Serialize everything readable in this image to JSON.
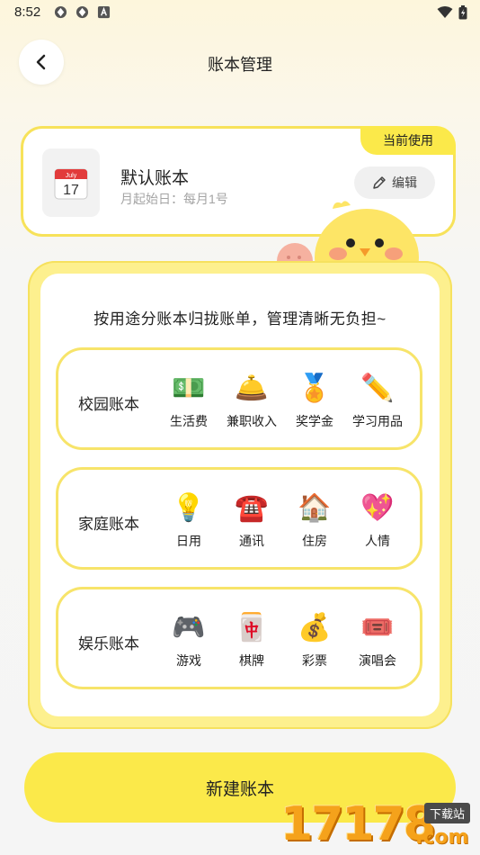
{
  "status_bar": {
    "time": "8:52"
  },
  "header": {
    "title": "账本管理"
  },
  "current_book": {
    "badge": "当前使用",
    "icon": "calendar-icon",
    "calendar_month": "July",
    "calendar_day": "17",
    "name": "默认账本",
    "subtitle": "月起始日：每月1号",
    "edit_label": "编辑"
  },
  "templates": {
    "headline": "按用途分账本归拢账单，管理清晰无负担~",
    "categories": [
      {
        "title": "校园账本",
        "items": [
          {
            "emoji": "💵",
            "label": "生活费"
          },
          {
            "emoji": "🛎️",
            "label": "兼职收入"
          },
          {
            "emoji": "🏅",
            "label": "奖学金"
          },
          {
            "emoji": "✏️",
            "label": "学习用品"
          }
        ]
      },
      {
        "title": "家庭账本",
        "items": [
          {
            "emoji": "💡",
            "label": "日用"
          },
          {
            "emoji": "☎️",
            "label": "通讯"
          },
          {
            "emoji": "🏠",
            "label": "住房"
          },
          {
            "emoji": "💖",
            "label": "人情"
          }
        ]
      },
      {
        "title": "娱乐账本",
        "items": [
          {
            "emoji": "🎮",
            "label": "游戏"
          },
          {
            "emoji": "🀄",
            "label": "棋牌"
          },
          {
            "emoji": "💰",
            "label": "彩票"
          },
          {
            "emoji": "🎟️",
            "label": "演唱会"
          }
        ]
      }
    ]
  },
  "footer": {
    "new_button_label": "新建账本"
  },
  "watermark": {
    "number": "17178",
    "tag": "下载站",
    "domain": ".com"
  },
  "colors": {
    "accent_yellow": "#fbe94a",
    "border_yellow": "#f7e25a"
  }
}
